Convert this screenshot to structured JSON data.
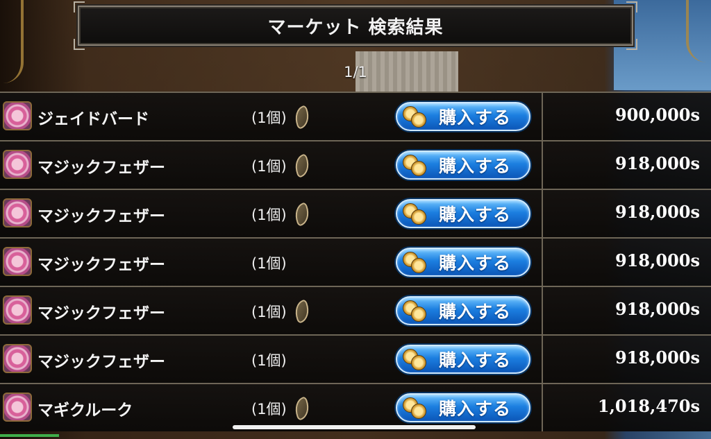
{
  "header": {
    "title": "マーケット 検索結果"
  },
  "pager": {
    "text": "1/1"
  },
  "buy_label": "購入する",
  "rows": [
    {
      "name": "ジェイドバード",
      "qty": "(1個)",
      "seed": true,
      "price": "900,000s"
    },
    {
      "name": "マジックフェザー",
      "qty": "(1個)",
      "seed": true,
      "price": "918,000s"
    },
    {
      "name": "マジックフェザー",
      "qty": "(1個)",
      "seed": true,
      "price": "918,000s"
    },
    {
      "name": "マジックフェザー",
      "qty": "(1個)",
      "seed": false,
      "price": "918,000s"
    },
    {
      "name": "マジックフェザー",
      "qty": "(1個)",
      "seed": true,
      "price": "918,000s"
    },
    {
      "name": "マジックフェザー",
      "qty": "(1個)",
      "seed": false,
      "price": "918,000s"
    },
    {
      "name": "マギクルーク",
      "qty": "(1個)",
      "seed": true,
      "price": "1,018,470s"
    }
  ],
  "icons": {
    "item": "ring-item-icon",
    "seed": "seed-icon",
    "coin": "coins-icon"
  },
  "colors": {
    "button_blue": "#1c7fe0",
    "frame": "#6e6657"
  }
}
